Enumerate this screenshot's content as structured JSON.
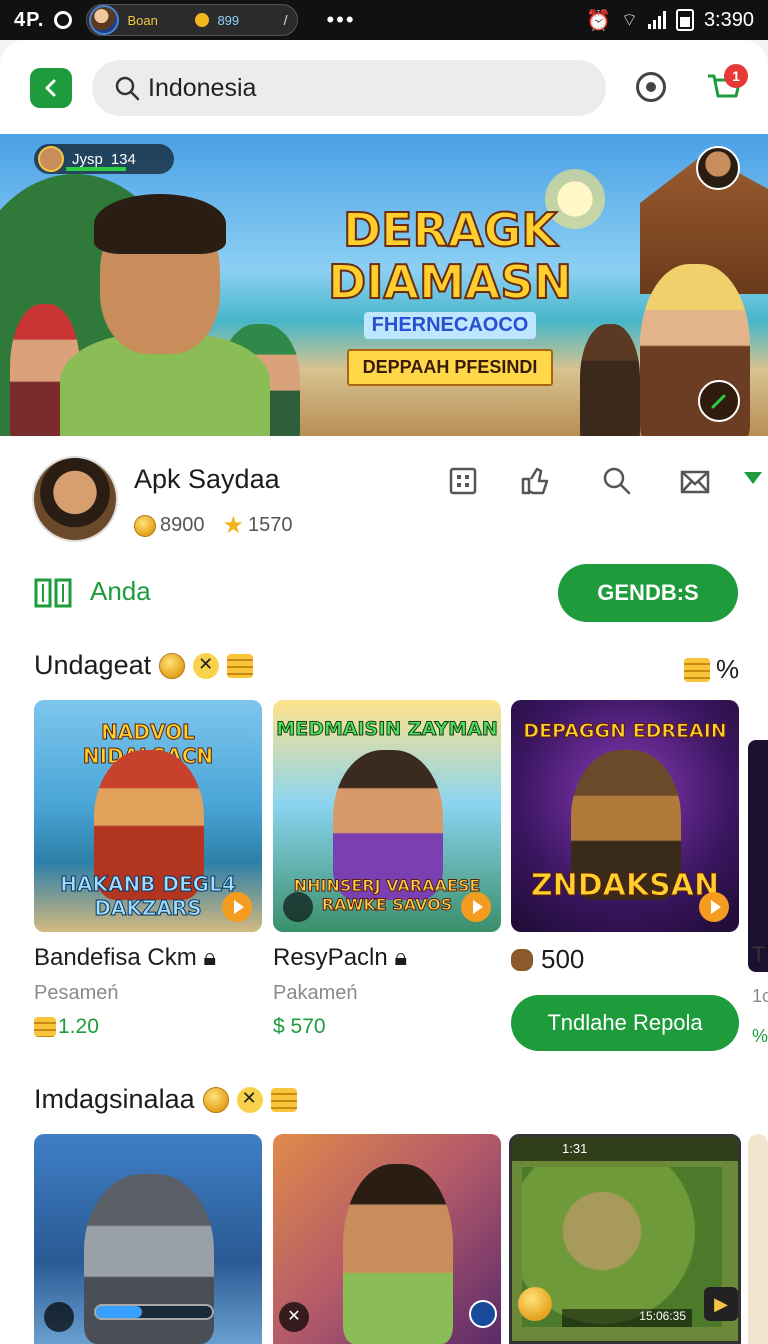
{
  "status_bar": {
    "left_text": "4P.",
    "game_name": "Boan",
    "game_value": "899",
    "right_time": "3:390"
  },
  "search": {
    "value": "Indonesia"
  },
  "cart": {
    "badge": "1"
  },
  "banner": {
    "title_line1": "DERAGK",
    "title_line2": "DIAMASN",
    "subtitle": "FHERNECAOCO",
    "ribbon": "DEPPAAH PFESINDI",
    "hud_name": "Jysp",
    "hud_level": "134"
  },
  "profile": {
    "username": "Apk Saydaa",
    "coins": "8900",
    "stars": "1570"
  },
  "anda": {
    "label": "Anda",
    "button": "GENDB:S"
  },
  "section1": {
    "title": "Undageat",
    "right_symbol": "%"
  },
  "cards": [
    {
      "name": "Bandefisa Ckm",
      "sub": "Pesameń",
      "price": "1.20",
      "img_title_top": "NADVOL NIDALSACN",
      "img_title_bottom": "HAKANB DEGL4 DAKZARS"
    },
    {
      "name": "ResyPacln",
      "sub": "Pakameń",
      "price": "$ 570",
      "img_title_top": "MEDMAISIN ZAYMAN",
      "img_title_bottom": "NHINSERJ VARAAESE RAWKE SAVOS"
    },
    {
      "count": "500",
      "action": "Tndlahe Repola",
      "img_title_top": "DEPAGGN EDREAIN",
      "img_title_bottom": "ZNDAKSAN"
    }
  ],
  "peek": {
    "name": "T",
    "sub": "1c",
    "price": "%"
  },
  "section2": {
    "title": "Imdagsinalaa"
  },
  "map_card": {
    "time": "1:31",
    "score": "15:06:35"
  },
  "colors": {
    "accent": "#1e9c3c",
    "badge": "#e53935",
    "coin": "#e5a11a"
  }
}
